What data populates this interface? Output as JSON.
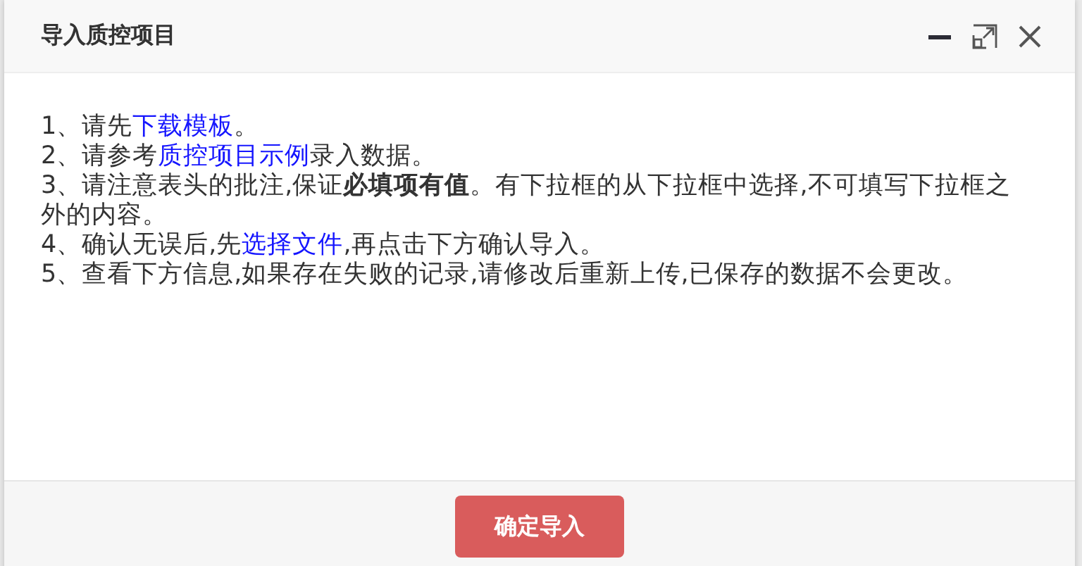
{
  "dialog": {
    "title": "导入质控项目",
    "controls": [
      {
        "kind": "minimize"
      },
      {
        "kind": "maximize"
      },
      {
        "kind": "close"
      }
    ]
  },
  "instructions": [
    [
      {
        "kind": "text",
        "text": "1、请先"
      },
      {
        "kind": "link",
        "text": "下载模板"
      },
      {
        "kind": "text",
        "text": "。"
      }
    ],
    [
      {
        "kind": "text",
        "text": "2、请参考"
      },
      {
        "kind": "link",
        "text": "质控项目示例"
      },
      {
        "kind": "text",
        "text": "录入数据。"
      }
    ],
    [
      {
        "kind": "text",
        "text": "3、请注意表头的批注,保证**必填项有值**。有下拉框的从下拉框中选择,不可填写下拉框之外的内容。"
      }
    ],
    [
      {
        "kind": "text",
        "text": "4、确认无误后,先"
      },
      {
        "kind": "link",
        "text": "选择文件"
      },
      {
        "kind": "text",
        "text": ",再点击下方确认导入。"
      }
    ],
    [
      {
        "kind": "text",
        "text": "5、查看下方信息,如果存在失败的记录,请修改后重新上传,已保存的数据不会更改。"
      }
    ]
  ],
  "confirm_button": "确定导入"
}
